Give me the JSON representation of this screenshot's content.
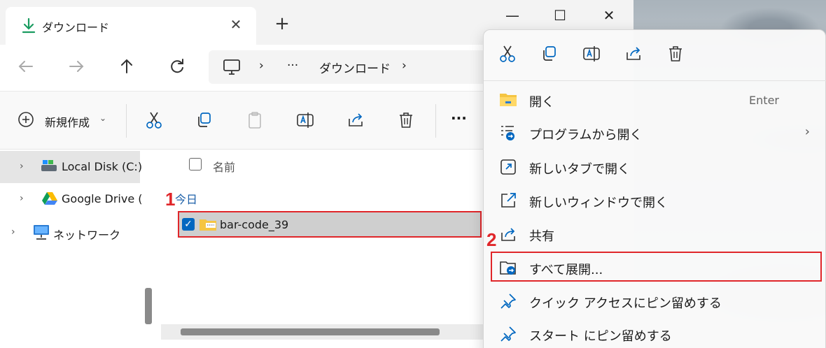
{
  "tab": {
    "title": "ダウンロード",
    "close": "✕",
    "new_tab": "+"
  },
  "window_controls": {
    "minimize": "—",
    "maximize": "☐",
    "close": "✕"
  },
  "nav": {
    "back": "←",
    "forward": "→",
    "up": "↑",
    "refresh": "↻",
    "address": [
      "›",
      "···",
      "ダウンロード",
      "›"
    ]
  },
  "commands": {
    "new_label": "新規作成",
    "more": "···"
  },
  "sidebar": {
    "items": [
      {
        "label": "Local Disk (C:)",
        "chevron": "›"
      },
      {
        "label": "Google Drive (",
        "chevron": "›"
      },
      {
        "label": "ネットワーク",
        "chevron": "›"
      }
    ]
  },
  "filelist": {
    "header_name": "名前",
    "group_today": "今日",
    "files": [
      {
        "name": "bar-code_39",
        "selected": true
      }
    ]
  },
  "context_menu": {
    "items": [
      {
        "label": "開く",
        "shortcut": "Enter",
        "icon": "folder-icon"
      },
      {
        "label": "プログラムから開く",
        "submenu": "›",
        "icon": "open-with-icon"
      },
      {
        "label": "新しいタブで開く",
        "icon": "new-tab-icon"
      },
      {
        "label": "新しいウィンドウで開く",
        "icon": "new-window-icon"
      },
      {
        "label": "共有",
        "icon": "share-icon"
      },
      {
        "label": "すべて展開...",
        "icon": "extract-all-icon"
      },
      {
        "label": "クイック アクセスにピン留めする",
        "icon": "pin-icon"
      },
      {
        "label": "スタート にピン留めする",
        "icon": "pin-icon"
      }
    ]
  },
  "annotations": {
    "step1": "1",
    "step2": "2"
  },
  "colors": {
    "accent": "#0067c0",
    "highlight": "#e0262a",
    "selection": "#cce4f7"
  }
}
